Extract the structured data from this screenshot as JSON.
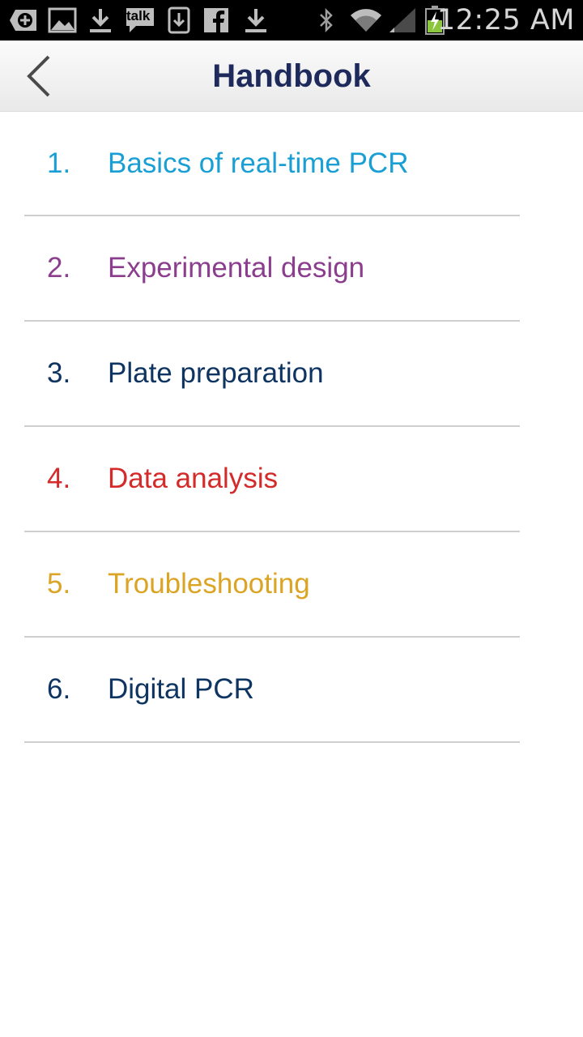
{
  "status_bar": {
    "time": "12:25 AM",
    "icons": [
      "add-notification-icon",
      "gallery-icon",
      "download-icon",
      "talk-icon",
      "download-box-icon",
      "facebook-icon",
      "download-icon",
      "bluetooth-icon",
      "wifi-icon",
      "signal-icon",
      "battery-charging-icon"
    ],
    "talk_label": "talk"
  },
  "header": {
    "title": "Handbook",
    "back_icon": "chevron-left-icon"
  },
  "menu": {
    "items": [
      {
        "num": "1.",
        "label": "Basics of real-time PCR",
        "color": "#1a9fd4"
      },
      {
        "num": "2.",
        "label": "Experimental design",
        "color": "#8b3d8e"
      },
      {
        "num": "3.",
        "label": "Plate preparation",
        "color": "#0e3462"
      },
      {
        "num": "4.",
        "label": "Data analysis",
        "color": "#d42a2a"
      },
      {
        "num": "5.",
        "label": "Troubleshooting",
        "color": "#dba425"
      },
      {
        "num": "6.",
        "label": "Digital PCR",
        "color": "#0e3462"
      }
    ]
  }
}
